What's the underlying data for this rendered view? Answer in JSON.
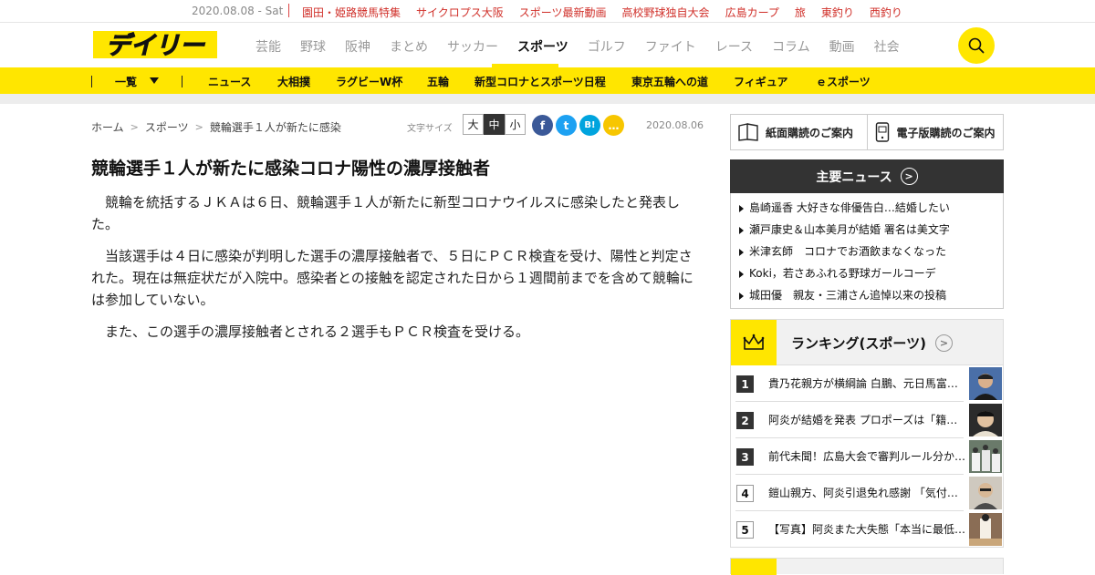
{
  "topbar": {
    "date": "2020.08.08 - Sat",
    "links": [
      "園田・姫路競馬特集",
      "サイクロプス大阪",
      "スポーツ最新動画",
      "高校野球独自大会",
      "広島カープ",
      "旅",
      "東釣り",
      "西釣り"
    ]
  },
  "header": {
    "logo_text": "デイリー",
    "nav": [
      "芸能",
      "野球",
      "阪神",
      "まとめ",
      "サッカー",
      "スポーツ",
      "ゴルフ",
      "ファイト",
      "レース",
      "コラム",
      "動画",
      "社会"
    ],
    "active_nav": "スポーツ",
    "search_icon": "search-icon",
    "accent_color": "#ffe600"
  },
  "subnav": {
    "dropdown_label": "一覧",
    "items": [
      "ニュース",
      "大相撲",
      "ラグビーW杯",
      "五輪",
      "新型コロナとスポーツ日程",
      "東京五輪への道",
      "フィギュア",
      "ｅスポーツ"
    ]
  },
  "breadcrumb": [
    "ホーム",
    "スポーツ",
    "競輪選手１人が新たに感染"
  ],
  "fontsize": {
    "label": "文字サイズ",
    "options": [
      "大",
      "中",
      "小"
    ],
    "selected": "中"
  },
  "social": [
    {
      "icon": "facebook-icon",
      "glyph": "f",
      "color": "#3b5998"
    },
    {
      "icon": "twitter-icon",
      "glyph": "t",
      "color": "#1da1f2"
    },
    {
      "icon": "hatena-bookmark-icon",
      "glyph": "B!",
      "color": "#00a4de"
    },
    {
      "icon": "comment-icon",
      "glyph": "…",
      "color": "#f7c600"
    }
  ],
  "article": {
    "date": "2020.08.06",
    "headline": "競輪選手１人が新たに感染コロナ陽性の濃厚接触者",
    "paragraphs": [
      "競輪を統括するＪＫＡは６日、競輪選手１人が新たに新型コロナウイルスに感染したと発表した。",
      "当該選手は４日に感染が判明した選手の濃厚接触者で、５日にＰＣＲ検査を受け、陽性と判定された。現在は無症状だが入院中。感染者との接触を認定された日から１週間前までを含めて競輪には参加していない。",
      "また、この選手の濃厚接触者とされる２選手もＰＣＲ検査を受ける。"
    ]
  },
  "sidebar": {
    "subscribe": [
      "紙面購読のご案内",
      "電子版購読のご案内"
    ],
    "news_title": "主要ニュース",
    "news": [
      "島崎遥香 大好きな俳優告白…結婚したい",
      "瀬戸康史＆山本美月が結婚 署名は美文字",
      "米津玄師　コロナでお酒飲まなくなった",
      "Koki，若さあふれる野球ガールコーデ",
      "城田優　親友・三浦さん追悼以来の投稿"
    ],
    "ranking_title": "ランキング(スポーツ)",
    "ranking": [
      {
        "rank": "1",
        "text": "貴乃花親方が横綱論 白鵬、元日馬富…"
      },
      {
        "rank": "2",
        "text": "阿炎が結婚を発表 プロポーズは「籍…"
      },
      {
        "rank": "3",
        "text": "前代未聞！広島大会で審判ルール分か…"
      },
      {
        "rank": "4",
        "text": "鎧山親方、阿炎引退免れ感謝 「気付…"
      },
      {
        "rank": "5",
        "text": "【写真】阿炎また大失態「本当に最低…"
      }
    ]
  }
}
